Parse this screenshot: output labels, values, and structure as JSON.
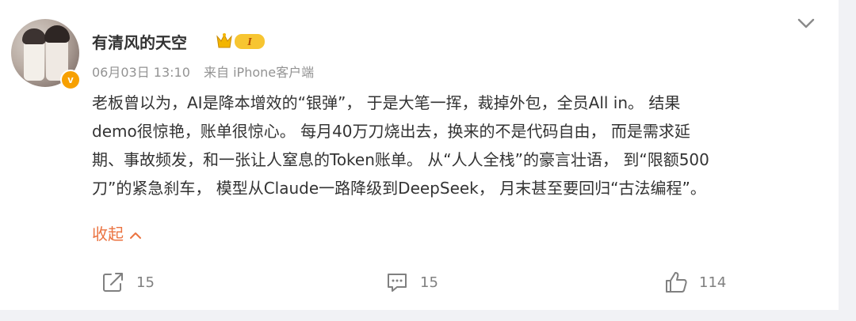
{
  "post": {
    "username": "有清风的天空",
    "vip_level": "I",
    "verified_badge": "v",
    "date": "06月03日 13:10",
    "source": "来自 iPhone客户端",
    "lines": [
      "老板曾以为，AI是降本增效的“银弹”，  于是大笔一挥，裁掉外包，全员All in。 结果",
      "demo很惊艳，账单很惊心。  每月40万刀烧出去，换来的不是代码自由，  而是需求延",
      "期、事故频发，和一张让人窒息的Token账单。 从“人人全栈”的豪言壮语，  到“限额500",
      "刀”的紧急刹车，  模型从Claude一路降级到DeepSeek，  月末甚至要回归“古法编程”。"
    ],
    "collapse_label": "收起"
  },
  "actions": {
    "repost_count": "15",
    "comment_count": "15",
    "like_count": "114"
  },
  "icons": {
    "more": "chevron-down-icon",
    "repost": "share-icon",
    "comment": "comment-icon",
    "like": "thumbs-up-icon"
  },
  "colors": {
    "link": "#eb7340",
    "meta": "#939393",
    "vip_gold": "#f7b500"
  }
}
